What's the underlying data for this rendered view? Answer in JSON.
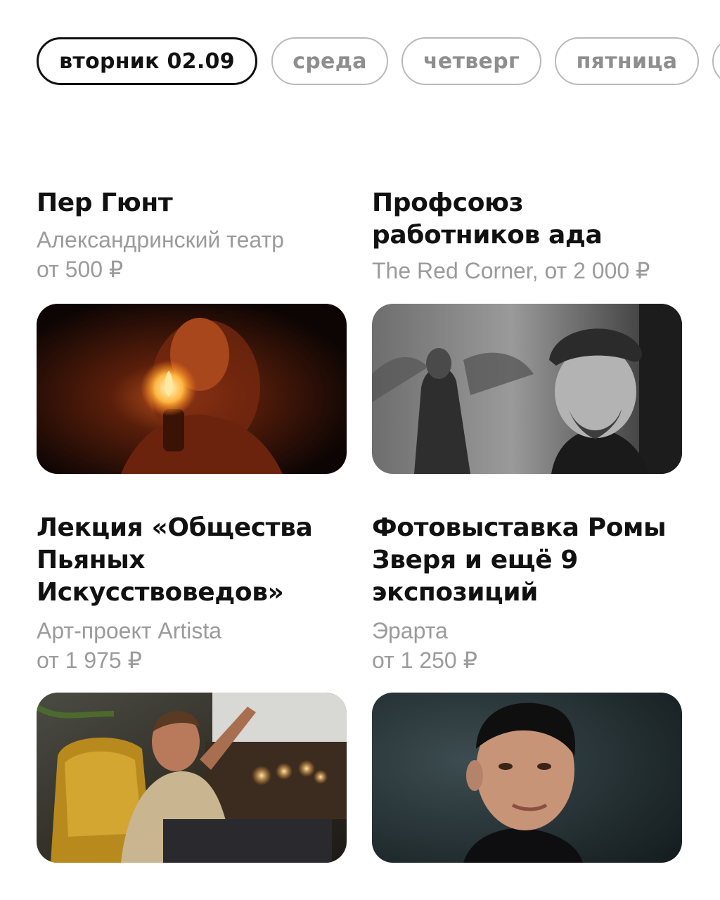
{
  "day_tabs": [
    {
      "label": "вторник 02.09",
      "active": true
    },
    {
      "label": "среда",
      "active": false
    },
    {
      "label": "четверг",
      "active": false
    },
    {
      "label": "пятница",
      "active": false
    }
  ],
  "events": [
    {
      "title": "Пер Гюнт",
      "venue": "Александринский театр",
      "price": "от 500 ₽",
      "photo": "actor-holding-candle-in-dark-photo"
    },
    {
      "title": "Профсоюз работников ада",
      "venue_price": "The Red Corner, от 2 000 ₽",
      "photo": "bw-man-in-flat-cap-collage-photo"
    },
    {
      "title": "Лекция «Общества Пьяных Искусствоведов»",
      "venue": "Арт-проект Artista",
      "price": "от 1 975 ₽",
      "photo": "lecturer-in-yellow-armchair-photo"
    },
    {
      "title": "Фотовыставка Ромы Зверя и ещё 9 экспозиций",
      "venue": "Эрарта",
      "price": "от 1 250 ₽",
      "photo": "portrait-man-dark-background-photo"
    }
  ]
}
